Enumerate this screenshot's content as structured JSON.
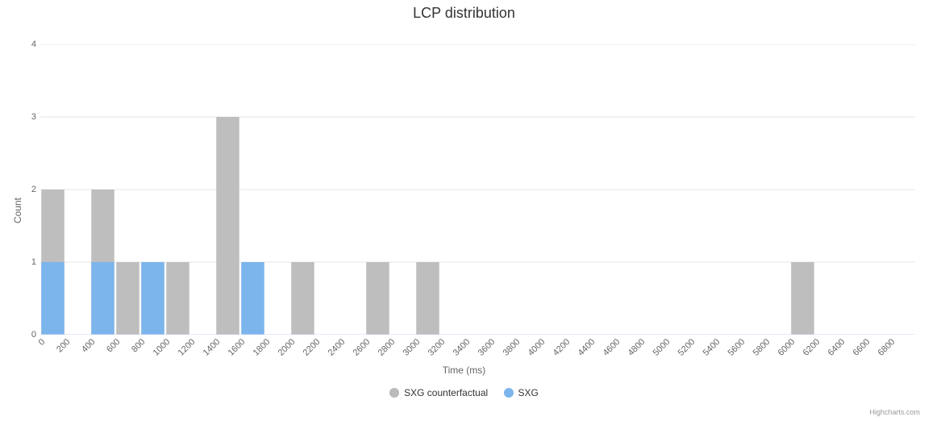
{
  "title": "LCP distribution",
  "xlabel": "Time (ms)",
  "ylabel": "Count",
  "credits": "Highcharts.com",
  "legend": {
    "cf": "SXG counterfactual",
    "sxg": "SXG"
  },
  "chart_data": {
    "type": "bar",
    "title": "LCP distribution",
    "xlabel": "Time (ms)",
    "ylabel": "Count",
    "ylim": [
      0,
      4
    ],
    "y_ticks": [
      0,
      1,
      2,
      3,
      4
    ],
    "categories": [
      0,
      200,
      400,
      600,
      800,
      1000,
      1200,
      1400,
      1600,
      1800,
      2000,
      2200,
      2400,
      2600,
      2800,
      3000,
      3200,
      3400,
      3600,
      3800,
      4000,
      4200,
      4400,
      4600,
      4800,
      5000,
      5200,
      5400,
      5600,
      5800,
      6000,
      6200,
      6400,
      6600,
      6800
    ],
    "series": [
      {
        "name": "SXG counterfactual",
        "color": "#bababa",
        "values": [
          2,
          0,
          2,
          1,
          1,
          1,
          0,
          3,
          0,
          0,
          1,
          0,
          0,
          1,
          0,
          1,
          0,
          0,
          0,
          0,
          0,
          0,
          0,
          0,
          0,
          0,
          0,
          0,
          0,
          0,
          1,
          0,
          0,
          0,
          0
        ]
      },
      {
        "name": "SXG",
        "color": "#7cb5ec",
        "values": [
          1,
          0,
          1,
          0,
          1,
          0,
          0,
          0,
          1,
          0,
          0,
          0,
          0,
          0,
          0,
          0,
          0,
          0,
          0,
          0,
          0,
          0,
          0,
          0,
          0,
          0,
          0,
          0,
          0,
          0,
          0,
          0,
          0,
          0,
          0
        ]
      }
    ],
    "legend_position": "bottom",
    "grid": true
  }
}
